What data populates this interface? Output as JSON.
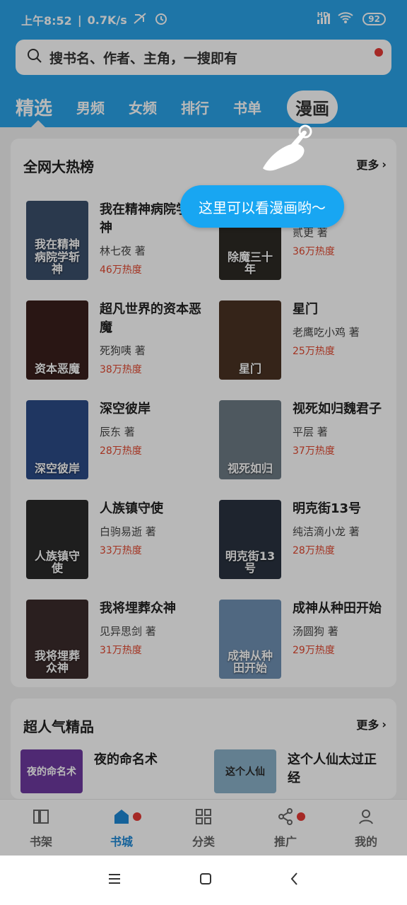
{
  "status_bar": {
    "time": "上午8:52",
    "network_speed": "0.7K/s",
    "hd_label": "HD",
    "battery": "92"
  },
  "search": {
    "placeholder": "搜书名、作者、主角，一搜即有"
  },
  "tabs": [
    {
      "label": "精选"
    },
    {
      "label": "男频"
    },
    {
      "label": "女频"
    },
    {
      "label": "排行"
    },
    {
      "label": "书单"
    },
    {
      "label": "漫画"
    }
  ],
  "tooltip": {
    "text": "这里可以看漫画哟～"
  },
  "hot_list": {
    "title": "全网大热榜",
    "more_label": "更多",
    "books": [
      {
        "title": "我在精神病院学斩神",
        "author": "林七夜 著",
        "heat": "46万热度",
        "cover_text": "我在精神病院学斩神",
        "cover_color": "#3b4f6b"
      },
      {
        "title": "除",
        "author": "贰更 著",
        "heat": "36万热度",
        "cover_text": "除魔三十年",
        "cover_color": "#2d2a25"
      },
      {
        "title": "超凡世界的资本恶魔",
        "author": "死狗咦 著",
        "heat": "38万热度",
        "cover_text": "资本恶魔",
        "cover_color": "#3a1f1c"
      },
      {
        "title": "星门",
        "author": "老鹰吃小鸡 著",
        "heat": "25万热度",
        "cover_text": "星门",
        "cover_color": "#4a3323"
      },
      {
        "title": "深空彼岸",
        "author": "辰东 著",
        "heat": "28万热度",
        "cover_text": "深空彼岸",
        "cover_color": "#2b4b87"
      },
      {
        "title": "视死如归魏君子",
        "author": "平层 著",
        "heat": "37万热度",
        "cover_text": "视死如归",
        "cover_color": "#6d7a84"
      },
      {
        "title": "人族镇守使",
        "author": "白驹易逝 著",
        "heat": "33万热度",
        "cover_text": "人族镇守使",
        "cover_color": "#2a2a2a"
      },
      {
        "title": "明克街13号",
        "author": "纯洁滴小龙 著",
        "heat": "28万热度",
        "cover_text": "明克街13号",
        "cover_color": "#2a3340"
      },
      {
        "title": "我将埋葬众神",
        "author": "见异思剑 著",
        "heat": "31万热度",
        "cover_text": "我将埋葬众神",
        "cover_color": "#3b2b2b"
      },
      {
        "title": "成神从种田开始",
        "author": "汤圆狗 著",
        "heat": "29万热度",
        "cover_text": "成神从种田开始",
        "cover_color": "#6f90b3"
      }
    ]
  },
  "popular": {
    "title": "超人气精品",
    "more_label": "更多",
    "books": [
      {
        "title": "夜的命名术",
        "cover_text": "夜的命名术",
        "cover_color": "#6e3aa0"
      },
      {
        "title": "这个人仙太过正经",
        "cover_text": "这个人仙",
        "cover_color": "#8ab0c8"
      }
    ]
  },
  "bottom_nav": [
    {
      "label": "书架",
      "icon": "bookshelf-icon"
    },
    {
      "label": "书城",
      "icon": "store-icon",
      "active": true,
      "badge": true
    },
    {
      "label": "分类",
      "icon": "category-icon"
    },
    {
      "label": "推广",
      "icon": "share-icon",
      "badge": true
    },
    {
      "label": "我的",
      "icon": "profile-icon"
    }
  ],
  "colors": {
    "brand": "#2aa3e8",
    "heat": "#e2472f",
    "badge": "#e53935"
  }
}
